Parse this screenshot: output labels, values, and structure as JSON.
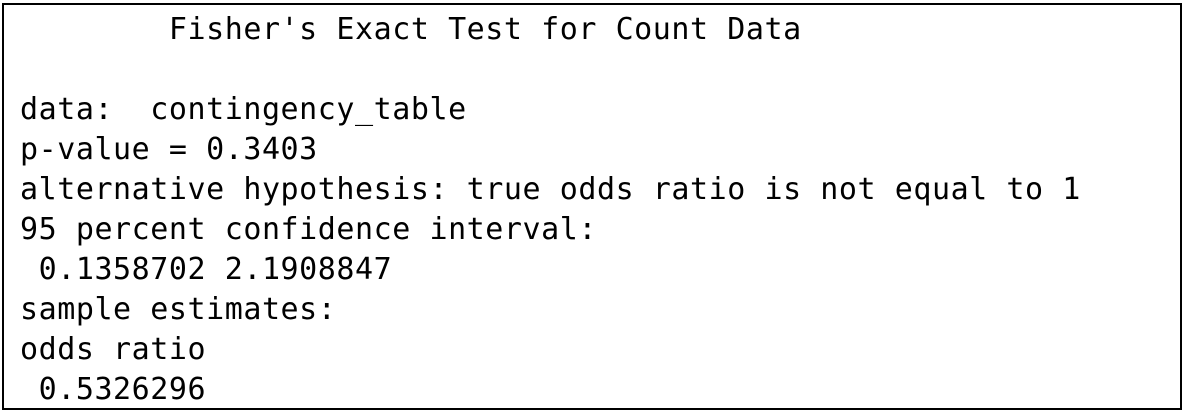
{
  "output": {
    "title": "        Fisher's Exact Test for Count Data",
    "data_line": "data:  contingency_table",
    "p_value_line": "p-value = 0.3403",
    "alternative_line": "alternative hypothesis: true odds ratio is not equal to 1",
    "ci_label": "95 percent confidence interval:",
    "ci_values": " 0.1358702 2.1908847",
    "estimates_label": "sample estimates:",
    "estimate_name": "odds ratio",
    "estimate_value": " 0.5326296"
  }
}
